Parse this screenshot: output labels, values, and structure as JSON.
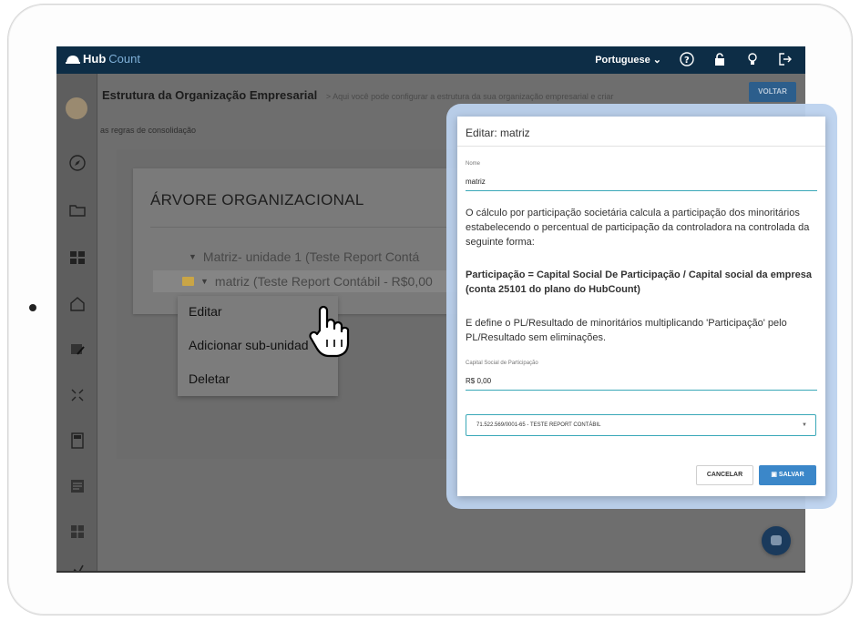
{
  "topbar": {
    "logo_hub": "Hub",
    "logo_count": "Count",
    "language": "Portuguese"
  },
  "page": {
    "title": "Estrutura da Organização Empresarial",
    "breadcrumb": "Aqui você pode configurar a estrutura da sua organização empresarial e criar",
    "subtitle": "as regras de consolidação",
    "back_button": "VOLTAR"
  },
  "tree": {
    "title": "ÁRVORE ORGANIZACIONAL",
    "items": [
      {
        "label": "Matriz- unidade 1 (Teste Report Contá"
      },
      {
        "label": "matriz (Teste Report Contábil - R$0,00"
      }
    ]
  },
  "context_menu": {
    "items": [
      {
        "label": "Editar"
      },
      {
        "label": "Adicionar sub-unidad"
      },
      {
        "label": "Deletar"
      }
    ]
  },
  "modal": {
    "title": "Editar: matriz",
    "name_label": "Nome",
    "name_value": "matriz",
    "desc_1": "O cálculo por participação societária calcula a participação dos minoritários estabelecendo o percentual de participação da controladora na controlada da seguinte forma:",
    "desc_2": "Participação = Capital Social De Participação / Capital social da empresa (conta 25101 do plano do HubCount)",
    "desc_3": "E define o PL/Resultado de minoritários multiplicando 'Participação' pelo PL/Resultado sem eliminações.",
    "capital_label": "Capital Social de Participação",
    "capital_value": "R$ 0,00",
    "company_select": "71.522.569/0001-65 - TESTE REPORT CONTÁBIL",
    "cancel_button": "CANCELAR",
    "save_button": "SALVAR"
  },
  "colors": {
    "topbar": "#0d2d46",
    "accent": "#3b87c9",
    "field_line": "#3aa8b8",
    "folder": "#e6b84e"
  }
}
